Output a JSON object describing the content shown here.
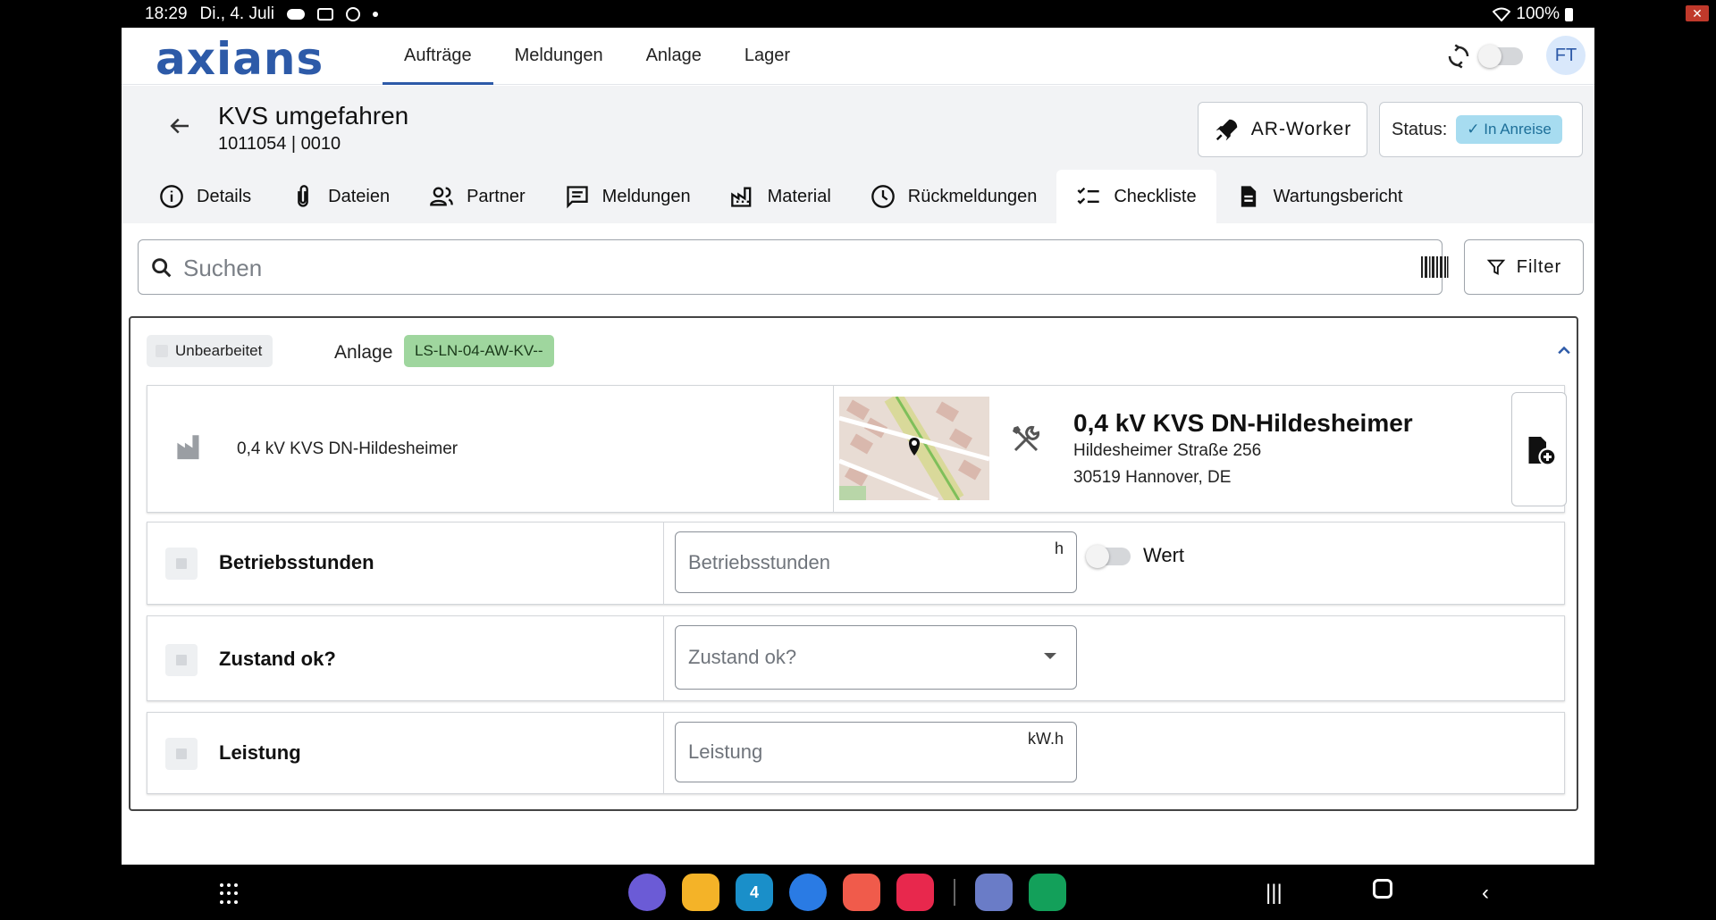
{
  "status_bar": {
    "time": "18:29",
    "date": "Di., 4. Juli",
    "battery": "100%"
  },
  "topnav": {
    "logo_text": "axians",
    "tabs": [
      {
        "label": "Aufträge",
        "active": true
      },
      {
        "label": "Meldungen",
        "active": false
      },
      {
        "label": "Anlage",
        "active": false
      },
      {
        "label": "Lager",
        "active": false
      }
    ],
    "avatar_initials": "FT"
  },
  "header": {
    "title": "KVS umgefahren",
    "subtitle": "1011054 | 0010",
    "ar_button_label": "AR-Worker",
    "status_label": "Status:",
    "status_value": "In Anreise",
    "tabs": [
      {
        "label": "Details",
        "icon": "info-icon"
      },
      {
        "label": "Dateien",
        "icon": "paperclip-icon"
      },
      {
        "label": "Partner",
        "icon": "people-icon"
      },
      {
        "label": "Meldungen",
        "icon": "message-icon"
      },
      {
        "label": "Material",
        "icon": "factory-icon"
      },
      {
        "label": "Rückmeldungen",
        "icon": "clock-icon"
      },
      {
        "label": "Checkliste",
        "icon": "checklist-icon",
        "active": true
      },
      {
        "label": "Wartungsbericht",
        "icon": "document-icon"
      }
    ]
  },
  "search": {
    "placeholder": "Suchen",
    "filter_label": "Filter"
  },
  "card": {
    "status_chip": "Unbearbeitet",
    "anlage_label": "Anlage",
    "anlage_value": "LS-LN-04-AW-KV--",
    "asset": {
      "name": "0,4 kV KVS DN-Hildesheimer",
      "title": "0,4 kV KVS DN-Hildesheimer",
      "address_line1": "Hildesheimer Straße 256",
      "address_line2": "30519 Hannover, DE"
    },
    "rows": [
      {
        "label": "Betriebsstunden",
        "placeholder": "Betriebsstunden",
        "unit": "h",
        "toggle_label": "Wert"
      },
      {
        "label": "Zustand ok?",
        "placeholder": "Zustand ok?"
      },
      {
        "label": "Leistung",
        "placeholder": "Leistung",
        "unit": "kW.h"
      }
    ]
  },
  "colors": {
    "brand_blue": "#2d5aa8",
    "brand_red": "#d6353f",
    "status_chip_bg": "#a7dcf0",
    "anlage_chip_bg": "#9fd69e"
  }
}
